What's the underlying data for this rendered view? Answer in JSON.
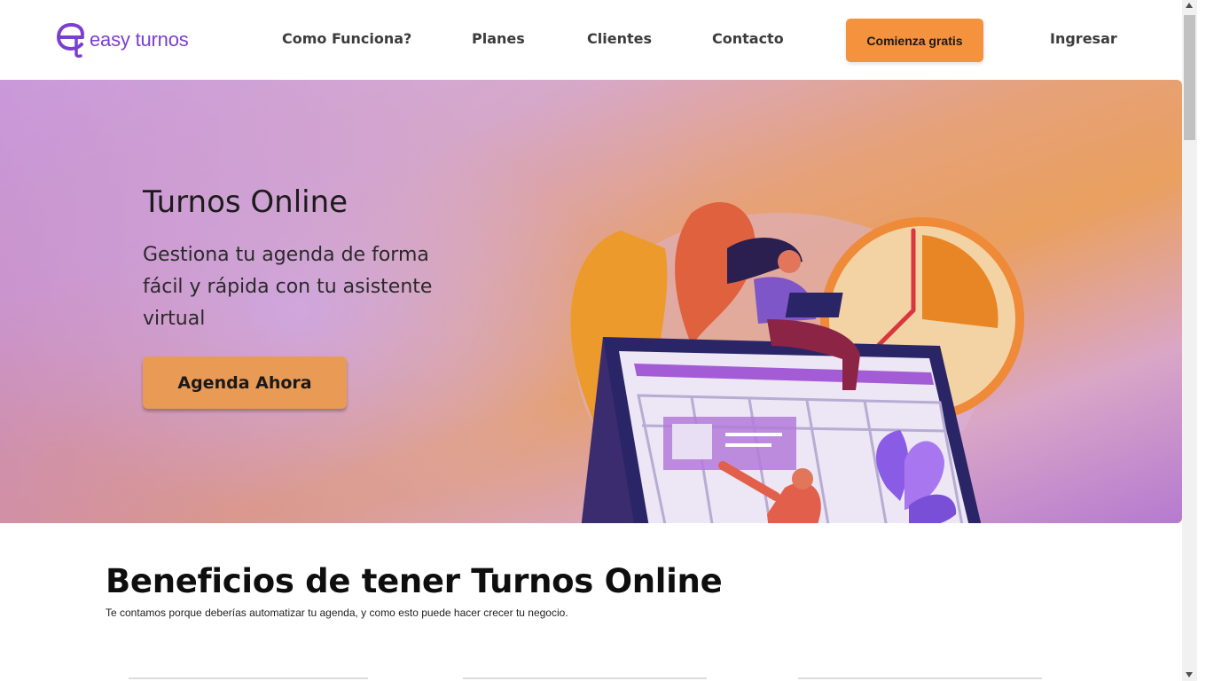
{
  "page": {
    "loading_progress": 0.2
  },
  "header": {
    "logo": {
      "mark": "e",
      "text": "easy turnos",
      "color": "#7a3fd1"
    },
    "nav": [
      {
        "label": "Como Funciona?"
      },
      {
        "label": "Planes"
      },
      {
        "label": "Clientes"
      },
      {
        "label": "Contacto"
      }
    ],
    "cta_label": "Comienza gratis",
    "cta_color": "#f5923e",
    "login_label": "Ingresar"
  },
  "hero": {
    "title": "Turnos Online",
    "subtitle": "Gestiona tu agenda de forma fácil y rápida con tu asistente virtual",
    "button_label": "Agenda Ahora",
    "button_color": "#e99a55",
    "illustration": "calendar-scheduling-illustration"
  },
  "benefits": {
    "title": "Beneficios de tener Turnos Online",
    "subtitle": "Te contamos porque deberías automatizar tu agenda, y como esto puede hacer crecer tu negocio."
  }
}
